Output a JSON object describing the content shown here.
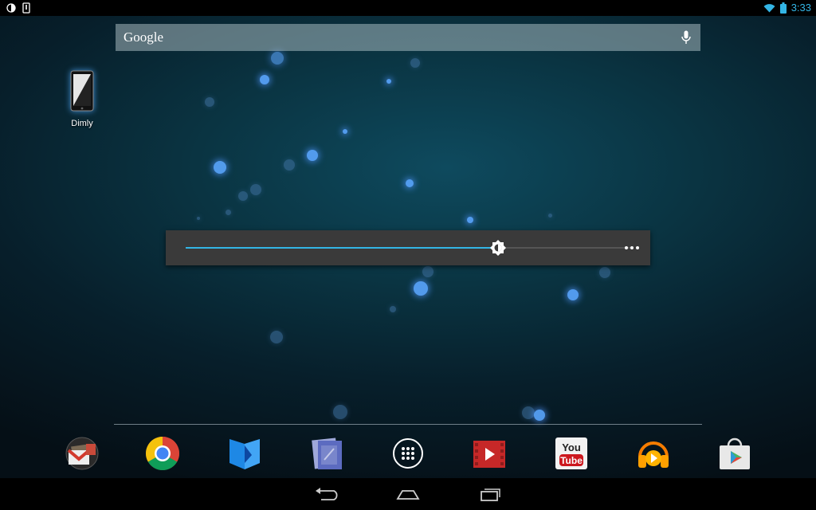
{
  "status_bar": {
    "left_icons": [
      "brightness-icon",
      "phone-notification-icon"
    ],
    "right_icons": [
      "wifi-icon",
      "battery-icon"
    ],
    "time": "3:33"
  },
  "search": {
    "logo": "Google",
    "mic_icon": "mic-icon"
  },
  "desktop_apps": [
    {
      "label": "Dimly",
      "icon": "dimly-app-icon"
    }
  ],
  "brightness_dialog": {
    "level_percent": 70,
    "brightness_icon": "brightness-icon",
    "more_icon": "overflow-menu-icon"
  },
  "dock": {
    "items": [
      {
        "name": "gmail",
        "icon": "gmail-icon"
      },
      {
        "name": "chrome",
        "icon": "chrome-icon"
      },
      {
        "name": "play-books",
        "icon": "play-books-icon"
      },
      {
        "name": "play-magazines",
        "icon": "play-magazines-icon"
      },
      {
        "name": "all-apps",
        "icon": "all-apps-icon"
      },
      {
        "name": "play-movies",
        "icon": "play-movies-icon"
      },
      {
        "name": "youtube",
        "icon": "youtube-icon",
        "text_top": "You",
        "text_bottom": "Tube"
      },
      {
        "name": "play-music",
        "icon": "play-music-icon"
      },
      {
        "name": "play-store",
        "icon": "play-store-icon"
      }
    ]
  },
  "nav_bar": {
    "buttons": [
      "back-icon",
      "home-icon",
      "recents-icon"
    ]
  },
  "colors": {
    "accent": "#33b5e5",
    "dialog_bg": "#3a3a3a",
    "status_bar_bg": "#000000"
  }
}
